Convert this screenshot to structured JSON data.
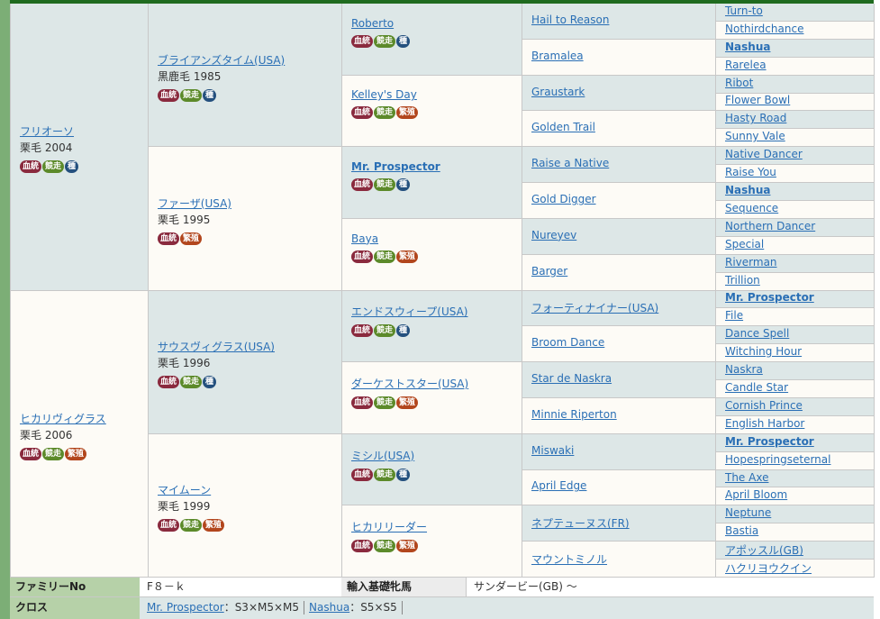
{
  "badge_labels": {
    "blood": "血統",
    "race": "競走",
    "stud": "種",
    "breed": "繁殖"
  },
  "gen1": [
    {
      "name": "フリオーソ",
      "sub": "栗毛 2004",
      "badges": [
        "blood",
        "race",
        "stud"
      ]
    },
    {
      "name": "ヒカリヴィグラス",
      "sub": "栗毛 2006",
      "badges": [
        "blood",
        "race",
        "breed"
      ]
    }
  ],
  "gen2": [
    {
      "name": "ブライアンズタイム(USA)",
      "sub": "黒鹿毛 1985",
      "badges": [
        "blood",
        "race",
        "stud"
      ]
    },
    {
      "name": "ファーザ(USA)",
      "sub": "栗毛 1995",
      "badges": [
        "blood",
        "breed"
      ]
    },
    {
      "name": "サウスヴィグラス(USA)",
      "sub": "栗毛 1996",
      "badges": [
        "blood",
        "race",
        "stud"
      ]
    },
    {
      "name": "マイムーン",
      "sub": "栗毛 1999",
      "badges": [
        "blood",
        "race",
        "breed"
      ]
    }
  ],
  "gen3": [
    {
      "name": "Roberto",
      "bold": false,
      "badges": [
        "blood",
        "race",
        "stud"
      ]
    },
    {
      "name": "Kelley's Day",
      "bold": false,
      "badges": [
        "blood",
        "race",
        "breed"
      ]
    },
    {
      "name": "Mr. Prospector",
      "bold": true,
      "badges": [
        "blood",
        "race",
        "stud"
      ]
    },
    {
      "name": "Baya",
      "bold": false,
      "badges": [
        "blood",
        "race",
        "breed"
      ]
    },
    {
      "name": "エンドスウィープ(USA)",
      "bold": false,
      "badges": [
        "blood",
        "race",
        "stud"
      ]
    },
    {
      "name": "ダーケストスター(USA)",
      "bold": false,
      "badges": [
        "blood",
        "race",
        "breed"
      ]
    },
    {
      "name": "ミシル(USA)",
      "bold": false,
      "badges": [
        "blood",
        "race",
        "stud"
      ]
    },
    {
      "name": "ヒカリリーダー",
      "bold": false,
      "badges": [
        "blood",
        "race",
        "breed"
      ]
    }
  ],
  "gen4": [
    {
      "name": "Hail to Reason",
      "bold": false
    },
    {
      "name": "Bramalea",
      "bold": false
    },
    {
      "name": "Graustark",
      "bold": false
    },
    {
      "name": "Golden Trail",
      "bold": false
    },
    {
      "name": "Raise a Native",
      "bold": false
    },
    {
      "name": "Gold Digger",
      "bold": false
    },
    {
      "name": "Nureyev",
      "bold": false
    },
    {
      "name": "Barger",
      "bold": false
    },
    {
      "name": "フォーティナイナー(USA)",
      "bold": false
    },
    {
      "name": "Broom Dance",
      "bold": false
    },
    {
      "name": "Star de Naskra",
      "bold": false
    },
    {
      "name": "Minnie Riperton",
      "bold": false
    },
    {
      "name": "Miswaki",
      "bold": false
    },
    {
      "name": "April Edge",
      "bold": false
    },
    {
      "name": "ネプテューヌス(FR)",
      "bold": false
    },
    {
      "name": "マウントミノル",
      "bold": false
    }
  ],
  "gen5": [
    {
      "name": "Turn-to",
      "bold": false
    },
    {
      "name": "Nothirdchance",
      "bold": false
    },
    {
      "name": "Nashua",
      "bold": true
    },
    {
      "name": "Rarelea",
      "bold": false
    },
    {
      "name": "Ribot",
      "bold": false
    },
    {
      "name": "Flower Bowl",
      "bold": false
    },
    {
      "name": "Hasty Road",
      "bold": false
    },
    {
      "name": "Sunny Vale",
      "bold": false
    },
    {
      "name": "Native Dancer",
      "bold": false
    },
    {
      "name": "Raise You",
      "bold": false
    },
    {
      "name": "Nashua",
      "bold": true
    },
    {
      "name": "Sequence",
      "bold": false
    },
    {
      "name": "Northern Dancer",
      "bold": false
    },
    {
      "name": "Special",
      "bold": false
    },
    {
      "name": "Riverman",
      "bold": false
    },
    {
      "name": "Trillion",
      "bold": false
    },
    {
      "name": "Mr. Prospector",
      "bold": true
    },
    {
      "name": "File",
      "bold": false
    },
    {
      "name": "Dance Spell",
      "bold": false
    },
    {
      "name": "Witching Hour",
      "bold": false
    },
    {
      "name": "Naskra",
      "bold": false
    },
    {
      "name": "Candle Star",
      "bold": false
    },
    {
      "name": "Cornish Prince",
      "bold": false
    },
    {
      "name": "English Harbor",
      "bold": false
    },
    {
      "name": "Mr. Prospector",
      "bold": true
    },
    {
      "name": "Hopespringseternal",
      "bold": false
    },
    {
      "name": "The Axe",
      "bold": false
    },
    {
      "name": "April Bloom",
      "bold": false
    },
    {
      "name": "Neptune",
      "bold": false
    },
    {
      "name": "Bastia",
      "bold": false
    },
    {
      "name": "アポッスル(GB)",
      "bold": false
    },
    {
      "name": "ハクリヨウクイン",
      "bold": false
    }
  ],
  "info": {
    "family_label": "ファミリーNo",
    "family_value": "F８－ｋ",
    "import_label": "輸入基礎牝馬",
    "import_value": "サンダービー(GB) 〜",
    "cross_label": "クロス",
    "crosses": [
      {
        "name": "Mr. Prospector",
        "value": "：S3×M5×M5"
      },
      {
        "name": "Nashua",
        "value": "：S5×S5"
      }
    ]
  },
  "colors": {
    "link": "#2a6fb5",
    "shade": "#dde7e7",
    "cream": "#fdfbf6",
    "label_bg": "#b6d1a8",
    "top_bar": "#1f6b1f",
    "badge_blood": "#8a2a3e",
    "badge_race": "#5c8a2a",
    "badge_stud": "#24507e",
    "badge_breed": "#b2461d"
  }
}
